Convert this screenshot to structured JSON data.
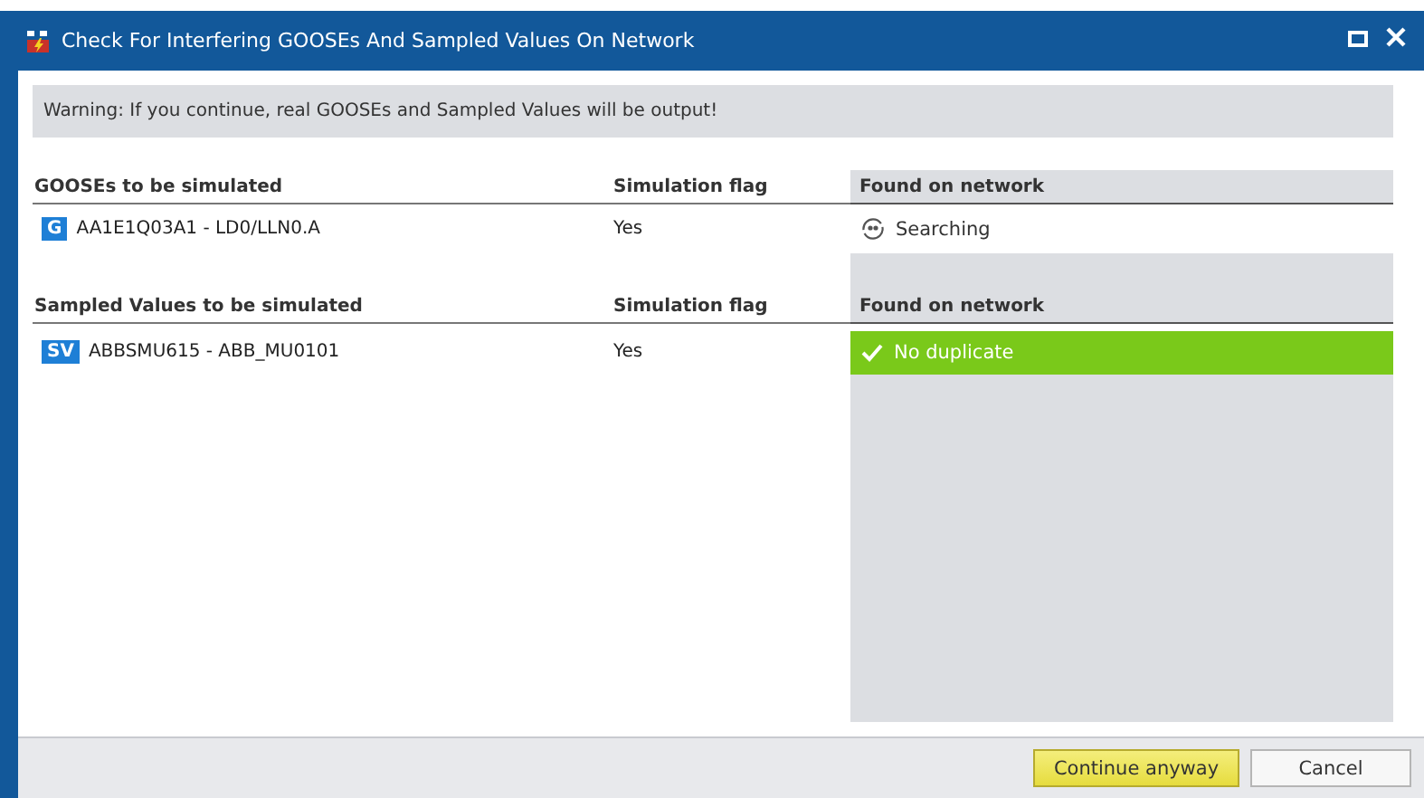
{
  "window": {
    "title": "Check For Interfering GOOSEs And Sampled Values On Network"
  },
  "warning": "Warning: If you continue, real GOOSEs and Sampled Values will be output!",
  "sections": [
    {
      "columns": [
        "GOOSEs to be simulated",
        "Simulation flag",
        "Found on network"
      ],
      "rows": [
        {
          "badge": "G",
          "name": "AA1E1Q03A1 - LD0/LLN0.A",
          "flag": "Yes",
          "status": {
            "kind": "searching",
            "text": "Searching"
          }
        }
      ]
    },
    {
      "columns": [
        "Sampled Values to be simulated",
        "Simulation flag",
        "Found on network"
      ],
      "rows": [
        {
          "badge": "SV",
          "name": "ABBSMU615 - ABB_MU0101",
          "flag": "Yes",
          "status": {
            "kind": "ok",
            "text": "No duplicate"
          }
        }
      ]
    }
  ],
  "buttons": [
    {
      "label": "Continue anyway",
      "kind": "primary"
    },
    {
      "label": "Cancel",
      "kind": "normal"
    }
  ]
}
